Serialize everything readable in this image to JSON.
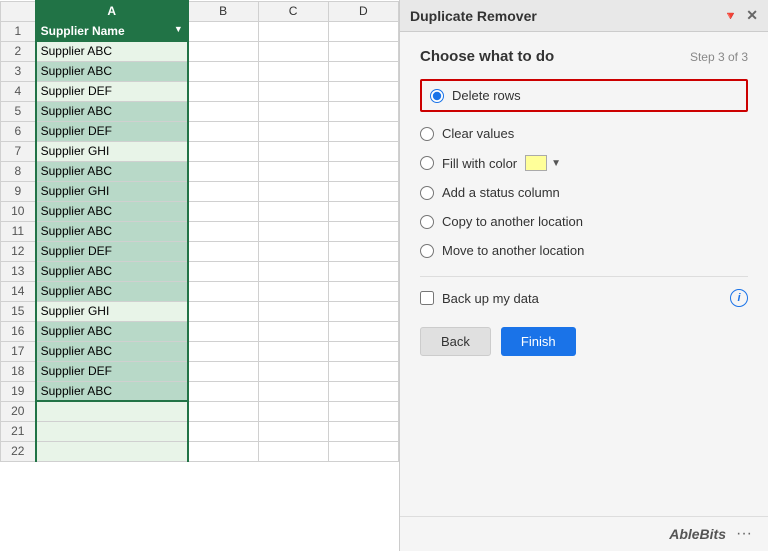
{
  "spreadsheet": {
    "columns": [
      "",
      "A",
      "B",
      "C",
      "D"
    ],
    "header_cell": "Supplier Name",
    "rows": [
      {
        "num": 2,
        "val": "Supplier ABC",
        "highlighted": false
      },
      {
        "num": 3,
        "val": "Supplier ABC",
        "highlighted": true
      },
      {
        "num": 4,
        "val": "Supplier DEF",
        "highlighted": false
      },
      {
        "num": 5,
        "val": "Supplier ABC",
        "highlighted": true
      },
      {
        "num": 6,
        "val": "Supplier DEF",
        "highlighted": true
      },
      {
        "num": 7,
        "val": "Supplier GHI",
        "highlighted": false
      },
      {
        "num": 8,
        "val": "Supplier ABC",
        "highlighted": true
      },
      {
        "num": 9,
        "val": "Supplier GHI",
        "highlighted": true
      },
      {
        "num": 10,
        "val": "Supplier ABC",
        "highlighted": true
      },
      {
        "num": 11,
        "val": "Supplier ABC",
        "highlighted": true
      },
      {
        "num": 12,
        "val": "Supplier DEF",
        "highlighted": true
      },
      {
        "num": 13,
        "val": "Supplier ABC",
        "highlighted": true
      },
      {
        "num": 14,
        "val": "Supplier ABC",
        "highlighted": true
      },
      {
        "num": 15,
        "val": "Supplier GHI",
        "highlighted": false
      },
      {
        "num": 16,
        "val": "Supplier ABC",
        "highlighted": true
      },
      {
        "num": 17,
        "val": "Supplier ABC",
        "highlighted": true
      },
      {
        "num": 18,
        "val": "Supplier DEF",
        "highlighted": true
      },
      {
        "num": 19,
        "val": "Supplier ABC",
        "highlighted": true
      },
      {
        "num": 20,
        "val": "",
        "highlighted": false
      },
      {
        "num": 21,
        "val": "",
        "highlighted": false
      },
      {
        "num": 22,
        "val": "",
        "highlighted": false
      }
    ]
  },
  "panel": {
    "title": "Duplicate Remover",
    "pin_icon": "📌",
    "close_icon": "✕",
    "section_title": "Choose what to do",
    "step_label": "Step 3 of 3",
    "options": [
      {
        "id": "delete_rows",
        "label": "Delete rows",
        "selected": true,
        "highlighted": true
      },
      {
        "id": "clear_values",
        "label": "Clear values",
        "selected": false
      },
      {
        "id": "fill_color",
        "label": "Fill with color",
        "selected": false,
        "has_color": true
      },
      {
        "id": "add_status",
        "label": "Add a status column",
        "selected": false
      },
      {
        "id": "copy_location",
        "label": "Copy to another location",
        "selected": false
      },
      {
        "id": "move_location",
        "label": "Move to another location",
        "selected": false
      }
    ],
    "backup_label": "Back up my data",
    "back_button": "Back",
    "finish_button": "Finish",
    "footer_brand": "AbleBits",
    "footer_menu": "···"
  }
}
